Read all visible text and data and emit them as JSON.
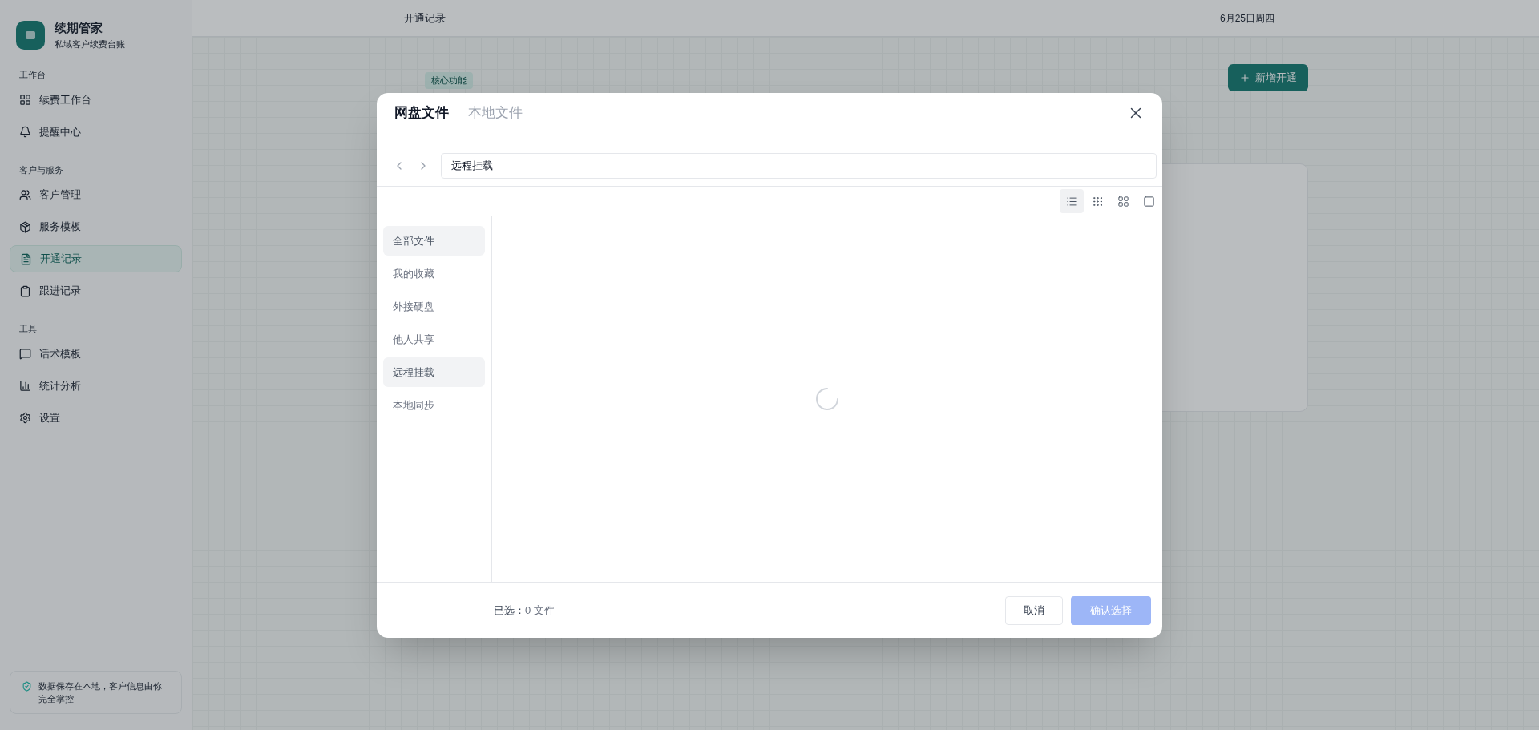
{
  "sidebar": {
    "brand": {
      "title": "续期管家",
      "subtitle": "私域客户续费台账"
    },
    "sections": [
      {
        "label": "工作台",
        "items": [
          {
            "label": "续费工作台",
            "kind": "grid",
            "selected": false
          },
          {
            "label": "提醒中心",
            "kind": "bell",
            "selected": false
          }
        ]
      },
      {
        "label": "客户与服务",
        "items": [
          {
            "label": "客户管理",
            "kind": "users",
            "selected": false
          },
          {
            "label": "服务模板",
            "kind": "package",
            "selected": false
          },
          {
            "label": "开通记录",
            "kind": "file",
            "selected": true
          },
          {
            "label": "跟进记录",
            "kind": "clipboard",
            "selected": false
          }
        ]
      },
      {
        "label": "工具",
        "items": [
          {
            "label": "话术模板",
            "kind": "message",
            "selected": false
          },
          {
            "label": "统计分析",
            "kind": "chart",
            "selected": false
          },
          {
            "label": "设置",
            "kind": "settings",
            "selected": false
          }
        ]
      }
    ],
    "notice": "数据保存在本地，客户信息由你完全掌控"
  },
  "topbar": {
    "title": "开通记录",
    "date": "6月25日周四"
  },
  "page": {
    "badge": "核心功能",
    "add_button": "新增开通"
  },
  "dialog": {
    "tabs": [
      {
        "label": "网盘文件",
        "selected": true
      },
      {
        "label": "本地文件",
        "selected": false
      }
    ],
    "path": "远程挂载",
    "view_modes": [
      {
        "kind": "list",
        "selected": true
      },
      {
        "kind": "dots",
        "selected": false
      },
      {
        "kind": "grid",
        "selected": false
      },
      {
        "kind": "columns",
        "selected": false
      }
    ],
    "nav": [
      {
        "label": "全部文件",
        "selected": true
      },
      {
        "label": "我的收藏",
        "selected": false
      },
      {
        "label": "外接硬盘",
        "selected": false
      },
      {
        "label": "他人共享",
        "selected": false
      },
      {
        "label": "远程挂载",
        "selected": true
      },
      {
        "label": "本地同步",
        "selected": false
      }
    ],
    "loading": true,
    "footer": {
      "selected_label": "已选：",
      "selected_count": "0 文件",
      "cancel": "取消",
      "confirm": "确认选择",
      "confirm_disabled": true
    }
  }
}
